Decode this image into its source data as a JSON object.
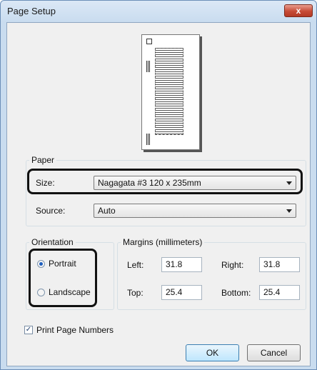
{
  "window": {
    "title": "Page Setup",
    "close_glyph": "x"
  },
  "paper": {
    "legend": "Paper",
    "size_label": "Size:",
    "size_value": "Nagagata #3 120 x 235mm",
    "source_label": "Source:",
    "source_value": "Auto"
  },
  "orientation": {
    "legend": "Orientation",
    "portrait": "Portrait",
    "landscape": "Landscape",
    "selected": "Portrait"
  },
  "margins": {
    "legend": "Margins (millimeters)",
    "left_label": "Left:",
    "left_value": "31.8",
    "right_label": "Right:",
    "right_value": "31.8",
    "top_label": "Top:",
    "top_value": "25.4",
    "bottom_label": "Bottom:",
    "bottom_value": "25.4"
  },
  "options": {
    "print_page_numbers": "Print Page Numbers",
    "checked": true
  },
  "buttons": {
    "ok": "OK",
    "cancel": "Cancel"
  }
}
